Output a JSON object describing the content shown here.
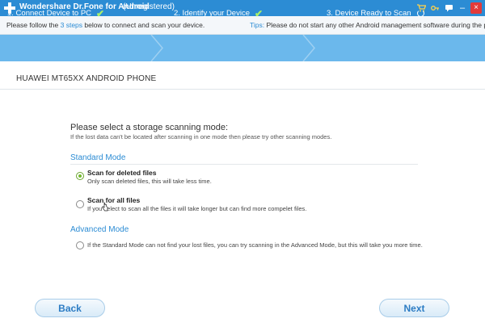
{
  "titlebar": {
    "app_name": "Wondershare Dr.Fone for Android",
    "registration_status": "(Unregistered)",
    "icons": [
      "cart-icon",
      "key-icon",
      "feedback-icon",
      "minimize-icon",
      "close-icon"
    ],
    "close_glyph": "×",
    "minimize_glyph": "–",
    "color": "#2c8cd4"
  },
  "hintbar": {
    "left_prefix": "Please follow the ",
    "left_highlight": "3 steps",
    "left_suffix": " below to connect and scan your device.",
    "tips_label": "Tips:",
    "tips_text": " Please do not start any other Android management software during the process."
  },
  "steps": [
    {
      "label": "1. Connect Device to PC",
      "status": "done"
    },
    {
      "label": "2. Identify your Device",
      "status": "done"
    },
    {
      "label": "3. Device Ready to Scan",
      "status": "in-progress"
    }
  ],
  "device": {
    "name": "HUAWEI MT65XX ANDROID PHONE"
  },
  "scan": {
    "prompt": "Please select a storage scanning mode:",
    "prompt_sub": "If the lost data can't be located after scanning in one mode then please try other scanning modes.",
    "standard_mode": {
      "title": "Standard Mode",
      "options": [
        {
          "title": "Scan for deleted files",
          "desc": "Only scan deleted files, this will take less time.",
          "selected": true
        },
        {
          "title": "Scan for all files",
          "desc": "If you select to scan all the files it will take longer but can find more compelet files.",
          "selected": false
        }
      ]
    },
    "advanced_mode": {
      "title": "Advanced Mode",
      "option_desc": "If the Standard Mode can not find your lost files, you can try scanning in the Advanced Mode, but this will take you more time.",
      "selected": false
    }
  },
  "buttons": {
    "back": "Back",
    "next": "Next"
  }
}
